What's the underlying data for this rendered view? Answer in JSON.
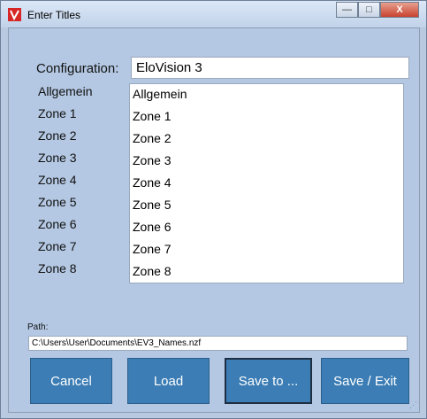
{
  "window": {
    "title": "Enter Titles"
  },
  "configuration": {
    "label": "Configuration:",
    "value": "EloVision 3"
  },
  "zones": {
    "labels": [
      "Allgemein",
      "Zone 1",
      "Zone 2",
      "Zone 3",
      "Zone 4",
      "Zone 5",
      "Zone 6",
      "Zone 7",
      "Zone 8"
    ],
    "values": [
      "Allgemein",
      "Zone 1",
      "Zone 2",
      "Zone 3",
      "Zone 4",
      "Zone 5",
      "Zone 6",
      "Zone 7",
      "Zone 8"
    ]
  },
  "path": {
    "label": "Path:",
    "value": "C:\\Users\\User\\Documents\\EV3_Names.nzf"
  },
  "buttons": {
    "cancel": "Cancel",
    "load": "Load",
    "save_to": "Save to ...",
    "save_exit": "Save / Exit"
  },
  "window_controls": {
    "minimize": "—",
    "maximize": "□",
    "close": "X"
  },
  "colors": {
    "button": "#3b7db4",
    "background": "#b4c8e3",
    "app_icon": "#d62626"
  }
}
